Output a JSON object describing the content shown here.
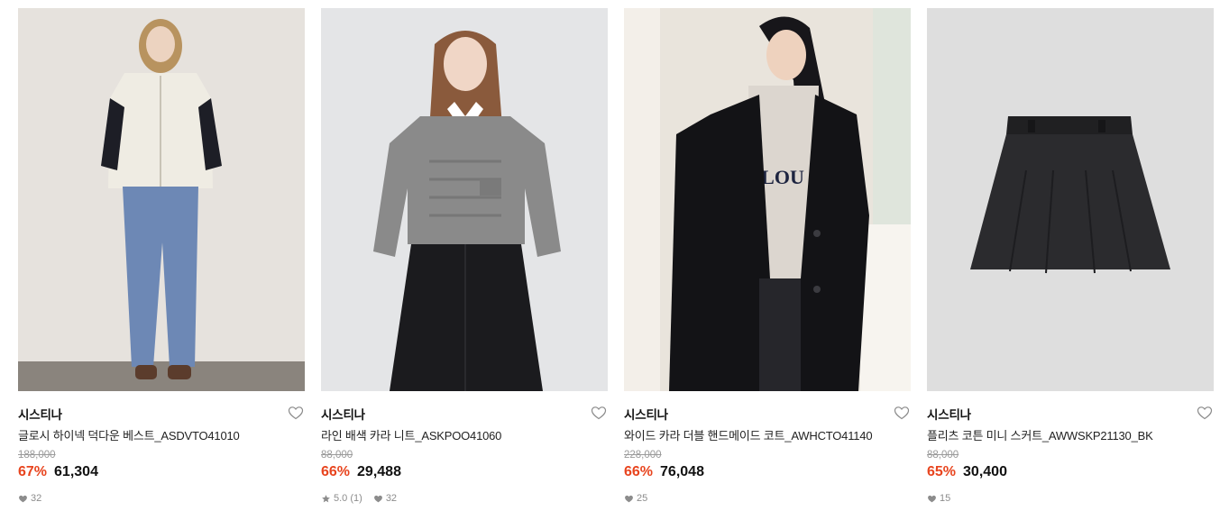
{
  "products": [
    {
      "brand": "시스티나",
      "name": "글로시 하이넥 덕다운 베스트_ASDVTO41010",
      "original_price": "188,000",
      "discount": "67%",
      "price": "61,304",
      "rating": "",
      "review_count": "",
      "likes": "32",
      "image": "model-ivory-puffer-vest-blue-jeans"
    },
    {
      "brand": "시스티나",
      "name": "라인 배색 카라 니트_ASKPOO41060",
      "original_price": "88,000",
      "discount": "66%",
      "price": "29,488",
      "rating": "5.0",
      "review_count": "(1)",
      "likes": "32",
      "image": "model-grey-cable-knit-collar-sweater"
    },
    {
      "brand": "시스티나",
      "name": "와이드 카라 더블 핸드메이드 코트_AWHCTO41140",
      "original_price": "228,000",
      "discount": "66%",
      "price": "76,048",
      "rating": "",
      "review_count": "",
      "likes": "25",
      "image": "model-black-double-coat-hoodie"
    },
    {
      "brand": "시스티나",
      "name": "플리츠 코튼 미니 스커트_AWWSKP21130_BK",
      "original_price": "88,000",
      "discount": "65%",
      "price": "30,400",
      "rating": "",
      "review_count": "",
      "likes": "15",
      "image": "black-pleated-mini-skirt"
    }
  ],
  "colors": {
    "discount": "#e8451f",
    "text": "#111111",
    "muted": "#8c8c8c",
    "strike": "#9a9a9a"
  },
  "icons": {
    "like": "heart-outline-icon",
    "likes_count": "heart-filled-icon",
    "rating": "star-icon"
  }
}
